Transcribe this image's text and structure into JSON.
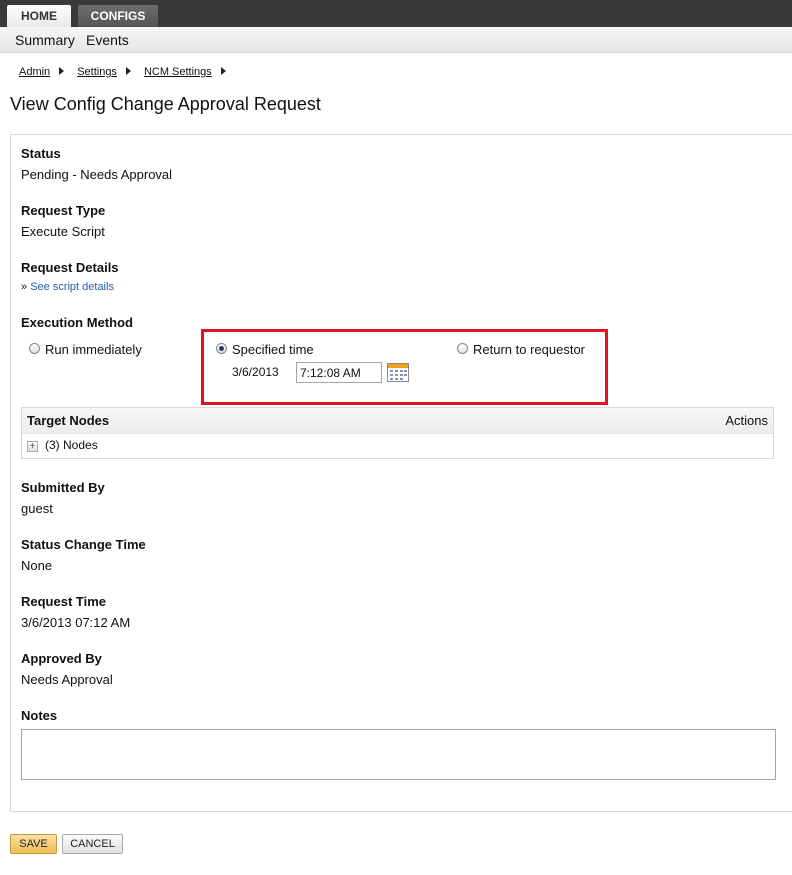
{
  "tabs": [
    {
      "label": "HOME",
      "active": true
    },
    {
      "label": "CONFIGS",
      "active": false
    }
  ],
  "subnav": [
    "Summary",
    "Events"
  ],
  "breadcrumb": [
    "Admin",
    "Settings",
    "NCM Settings"
  ],
  "page_title": "View Config Change Approval Request",
  "status": {
    "label": "Status",
    "value": "Pending - Needs Approval"
  },
  "request_type": {
    "label": "Request Type",
    "value": "Execute Script"
  },
  "request_details": {
    "label": "Request Details",
    "prefix": "»",
    "link": "See script details"
  },
  "execution_method": {
    "label": "Execution Method",
    "options": [
      "Run immediately",
      "Specified time",
      "Return to requestor"
    ],
    "selected": "Specified time",
    "date": "3/6/2013",
    "time": "7:12:08 AM"
  },
  "target_nodes": {
    "header": "Target Nodes",
    "actions": "Actions",
    "nodes_label": "(3) Nodes"
  },
  "submitted_by": {
    "label": "Submitted By",
    "value": "guest"
  },
  "status_change_time": {
    "label": "Status Change Time",
    "value": "None"
  },
  "request_time": {
    "label": "Request Time",
    "value": "3/6/2013 07:12 AM"
  },
  "approved_by": {
    "label": "Approved By",
    "value": "Needs Approval"
  },
  "notes": {
    "label": "Notes",
    "value": ""
  },
  "buttons": {
    "save": "SAVE",
    "cancel": "CANCEL"
  },
  "colors": {
    "highlight": "#e3141f",
    "link": "#1f5fa8",
    "save_button": "#f0bd55"
  },
  "icons": {
    "calendar": "calendar-icon",
    "expand": "plus-icon",
    "breadcrumb_sep": "triangle-right-icon"
  }
}
